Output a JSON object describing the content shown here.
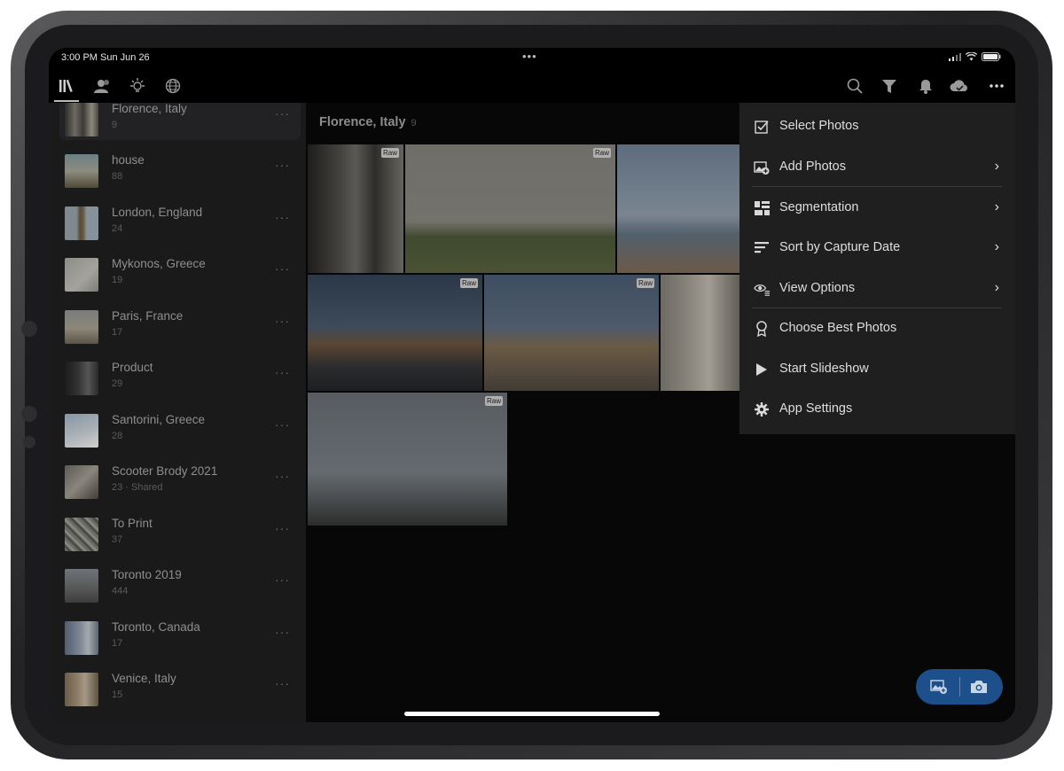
{
  "status": {
    "time_date": "3:00 PM  Sun Jun 26",
    "center": "•••"
  },
  "toolbar": {
    "left_icons": [
      "library-icon",
      "people-icon",
      "learn-icon",
      "discover-icon"
    ],
    "right_icons": [
      "search-icon",
      "filter-icon",
      "notification-icon",
      "cloud-icon",
      "more-icon"
    ]
  },
  "albums": [
    {
      "name": "Florence, Italy",
      "count": "9",
      "selected": true
    },
    {
      "name": "house",
      "count": "88"
    },
    {
      "name": "London, England",
      "count": "24"
    },
    {
      "name": "Mykonos, Greece",
      "count": "19"
    },
    {
      "name": "Paris, France",
      "count": "17"
    },
    {
      "name": "Product",
      "count": "29"
    },
    {
      "name": "Santorini, Greece",
      "count": "28"
    },
    {
      "name": "Scooter Brody 2021",
      "count": "23 · Shared"
    },
    {
      "name": "To Print",
      "count": "37"
    },
    {
      "name": "Toronto 2019",
      "count": "444"
    },
    {
      "name": "Toronto, Canada",
      "count": "17"
    },
    {
      "name": "Venice, Italy",
      "count": "15"
    }
  ],
  "album_more": "···",
  "main": {
    "title": "Florence, Italy",
    "count": "9"
  },
  "raw_badge": "Raw",
  "menu": {
    "items": [
      {
        "label": "Select Photos",
        "icon": "select-checkbox-icon",
        "submenu": false
      },
      {
        "label": "Add Photos",
        "icon": "add-photo-icon",
        "submenu": true
      },
      {
        "label": "Segmentation",
        "icon": "segmentation-icon",
        "submenu": true
      },
      {
        "label": "Sort by Capture Date",
        "icon": "sort-icon",
        "submenu": true
      },
      {
        "label": "View Options",
        "icon": "view-options-icon",
        "submenu": true
      },
      {
        "label": "Choose Best Photos",
        "icon": "award-icon",
        "submenu": false
      },
      {
        "label": "Start Slideshow",
        "icon": "play-icon",
        "submenu": false
      },
      {
        "label": "App Settings",
        "icon": "gear-icon",
        "submenu": false
      }
    ],
    "chevron": "›"
  },
  "colors": {
    "accent_fab": "#1d4f8a",
    "menu_bg": "#1f1f20",
    "sidebar_bg": "#1a1a1b"
  }
}
